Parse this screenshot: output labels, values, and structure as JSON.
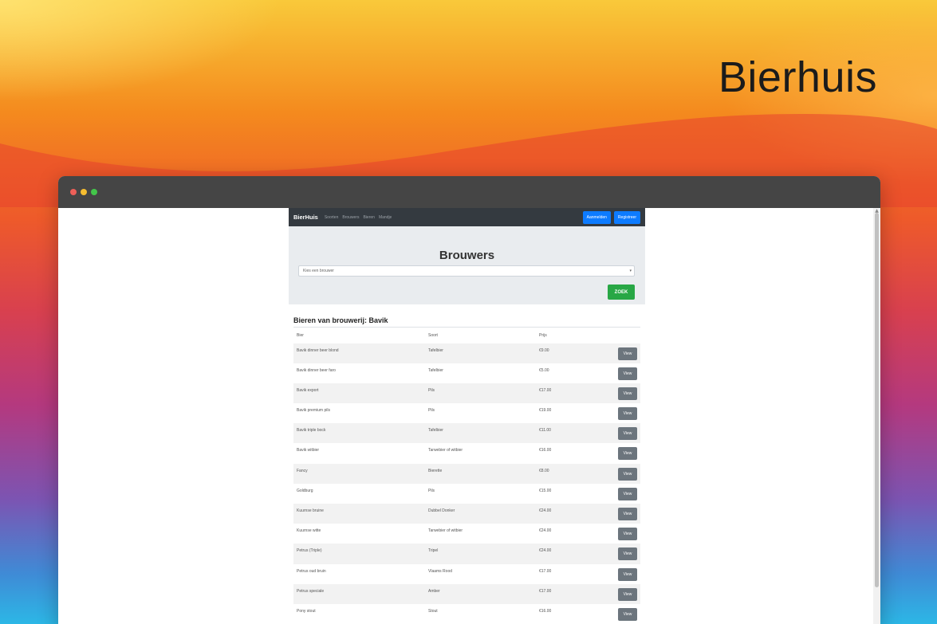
{
  "overlay": {
    "title": "Bierhuis"
  },
  "navbar": {
    "brand": "BierHuis",
    "links": [
      "Soorten",
      "Brouwers",
      "Bieren",
      "Mandje"
    ],
    "login_label": "Aanmelden",
    "register_label": "Registreer"
  },
  "jumbotron": {
    "title": "Brouwers",
    "select_value": "Kies een brouwer",
    "search_label": "ZOEK"
  },
  "results": {
    "title": "Bieren van brouwerij: Bavik",
    "columns": [
      "Bier",
      "Soort",
      "Prijs"
    ],
    "view_label": "View",
    "rows": [
      {
        "bier": "Bavik dinner beer blond",
        "soort": "Tafelbier",
        "prijs": "€9.00"
      },
      {
        "bier": "Bavik dinner beer faro",
        "soort": "Tafelbier",
        "prijs": "€5.00"
      },
      {
        "bier": "Bavik export",
        "soort": "Pils",
        "prijs": "€17.00"
      },
      {
        "bier": "Bavik premium pils",
        "soort": "Pils",
        "prijs": "€19.00"
      },
      {
        "bier": "Bavik triple bock",
        "soort": "Tafelbier",
        "prijs": "€11.00"
      },
      {
        "bier": "Bavik witbier",
        "soort": "Tarwebier of witbier",
        "prijs": "€16.00"
      },
      {
        "bier": "Fancy",
        "soort": "Bierette",
        "prijs": "€8.00"
      },
      {
        "bier": "Goldburg",
        "soort": "Pils",
        "prijs": "€15.00"
      },
      {
        "bier": "Kuurnse bruine",
        "soort": "Dubbel Donker",
        "prijs": "€24.00"
      },
      {
        "bier": "Kuurnse witte",
        "soort": "Tarwebier of witbier",
        "prijs": "€24.00"
      },
      {
        "bier": "Petrus (Triple)",
        "soort": "Tripel",
        "prijs": "€24.00"
      },
      {
        "bier": "Petrus oud bruin",
        "soort": "Vlaams Rood",
        "prijs": "€17.00"
      },
      {
        "bier": "Petrus speciale",
        "soort": "Amber",
        "prijs": "€17.00"
      },
      {
        "bier": "Pony stout",
        "soort": "Stout",
        "prijs": "€16.00"
      }
    ]
  }
}
